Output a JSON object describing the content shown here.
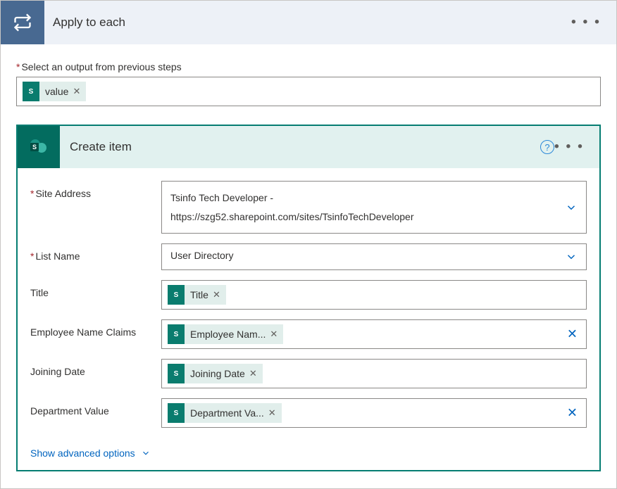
{
  "loop": {
    "title": "Apply to each",
    "output_label": "Select an output from previous steps",
    "value_token": "value"
  },
  "action": {
    "title": "Create item",
    "fields": {
      "site_label": "Site Address",
      "site_line1": "Tsinfo Tech Developer -",
      "site_line2": "https://szg52.sharepoint.com/sites/TsinfoTechDeveloper",
      "list_label": "List Name",
      "list_value": "User Directory",
      "title_label": "Title",
      "title_token": "Title",
      "emp_label": "Employee Name Claims",
      "emp_token": "Employee Nam...",
      "join_label": "Joining Date",
      "join_token": "Joining Date",
      "dept_label": "Department Value",
      "dept_token": "Department Va..."
    },
    "advanced_label": "Show advanced options"
  }
}
